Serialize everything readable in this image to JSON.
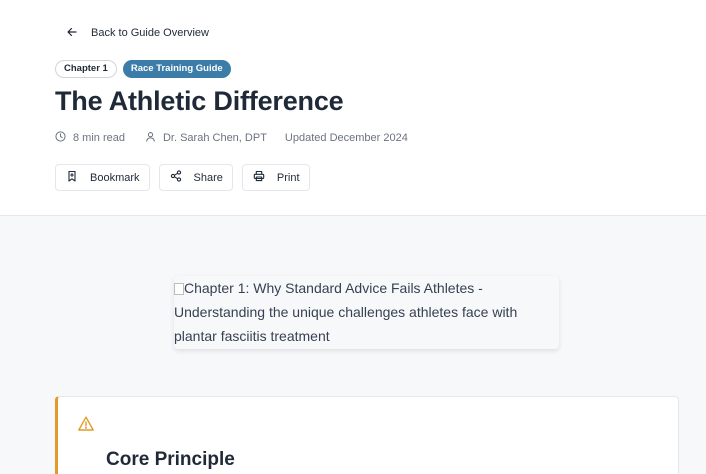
{
  "nav": {
    "back_label": "Back to Guide Overview"
  },
  "badges": {
    "chapter": "Chapter 1",
    "guide": "Race Training Guide"
  },
  "article": {
    "title": "The Athletic Difference",
    "read_time": "8 min read",
    "author": "Dr. Sarah Chen, DPT",
    "updated": "Updated December 2024"
  },
  "actions": {
    "bookmark": "Bookmark",
    "share": "Share",
    "print": "Print"
  },
  "hero_image": {
    "alt": "Chapter 1: Why Standard Advice Fails Athletes - Understanding the unique challenges athletes face with plantar fasciitis treatment"
  },
  "callout": {
    "title": "Core Principle",
    "icon": "warning-triangle-icon"
  },
  "colors": {
    "badge_fill": "#3b7ca8",
    "callout_accent": "#e39a2a",
    "content_bg": "#f7f8fa",
    "text": "#1f2937",
    "muted": "#6b7280"
  }
}
